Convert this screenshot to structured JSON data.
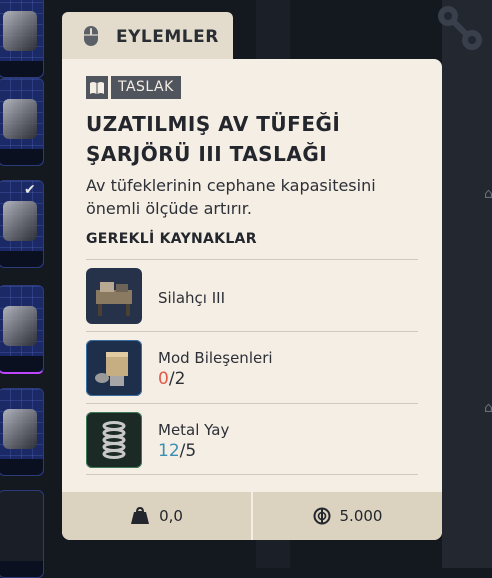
{
  "tab": {
    "label": "EYLEMLER",
    "icon": "mouse-icon"
  },
  "badge": {
    "icon": "book-icon",
    "label": "TASLAK"
  },
  "item": {
    "title": "UZATILMIŞ AV TÜFEĞİ ŞARJÖRÜ III TASLAĞI",
    "description": "Av tüfeklerinin cephane kapasitesini önemli ölçüde artırır."
  },
  "requirements": {
    "header": "GEREKLİ KAYNAKLAR",
    "items": [
      {
        "name": "Silahçı III",
        "icon": "workbench-icon"
      },
      {
        "name": "Mod Bileşenleri",
        "have": "0",
        "sep": "/",
        "need": "2",
        "icon": "mod-components-icon",
        "have_color": "#e05a47"
      },
      {
        "name": "Metal Yay",
        "have": "12",
        "sep": "/",
        "need": "5",
        "icon": "metal-spring-icon",
        "have_color": "#3c8fb3"
      }
    ]
  },
  "footer": {
    "weight": "0,0",
    "weight_icon": "weight-icon",
    "price": "5.000",
    "price_icon": "coin-icon"
  },
  "colors": {
    "card_bg": "#f4eee4",
    "tab_bg": "#e3dccc",
    "footer_bg": "#dcd2c0",
    "badge_bg": "#4f545d",
    "missing": "#e05a47",
    "sufficient": "#3c8fb3"
  }
}
